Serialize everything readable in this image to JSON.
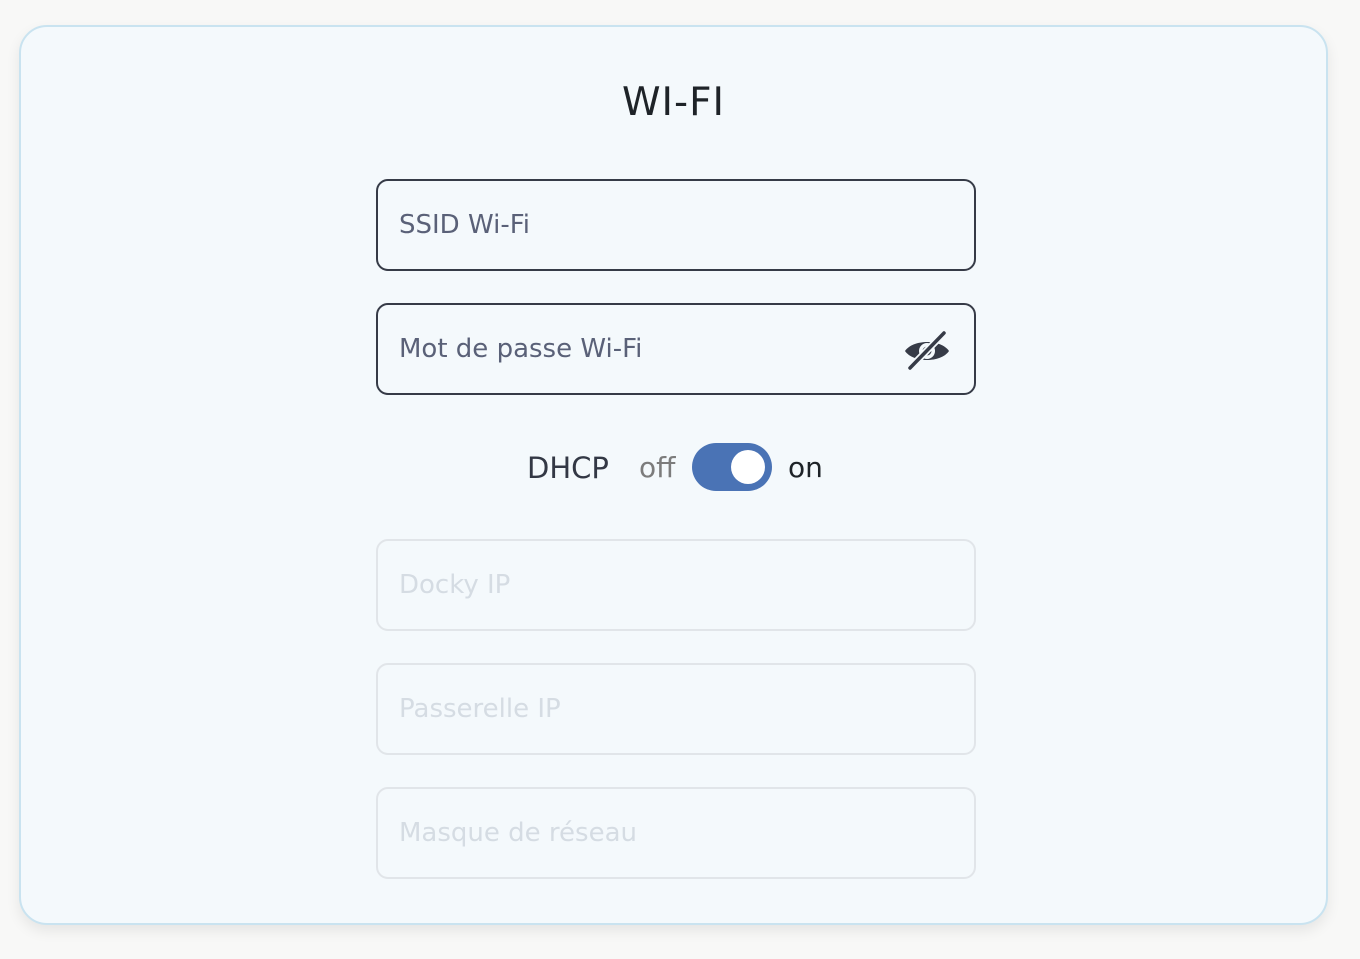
{
  "card": {
    "title": "WI-FI"
  },
  "fields": {
    "ssid": {
      "placeholder": "SSID Wi-Fi",
      "value": ""
    },
    "password": {
      "placeholder": "Mot de passe Wi-Fi",
      "value": "",
      "icon": "eye-slash-icon"
    },
    "docky_ip": {
      "placeholder": "Docky IP",
      "value": "",
      "disabled": true
    },
    "gateway_ip": {
      "placeholder": "Passerelle IP",
      "value": "",
      "disabled": true
    },
    "netmask": {
      "placeholder": "Masque de réseau",
      "value": "",
      "disabled": true
    }
  },
  "dhcp": {
    "label": "DHCP",
    "off_label": "off",
    "on_label": "on",
    "enabled": true
  },
  "colors": {
    "toggle_on": "#4a73b5",
    "card_background": "#f4f9fc",
    "card_border": "#c9e3f0",
    "active_border": "#363b47",
    "disabled_border": "#e1e5e9"
  }
}
